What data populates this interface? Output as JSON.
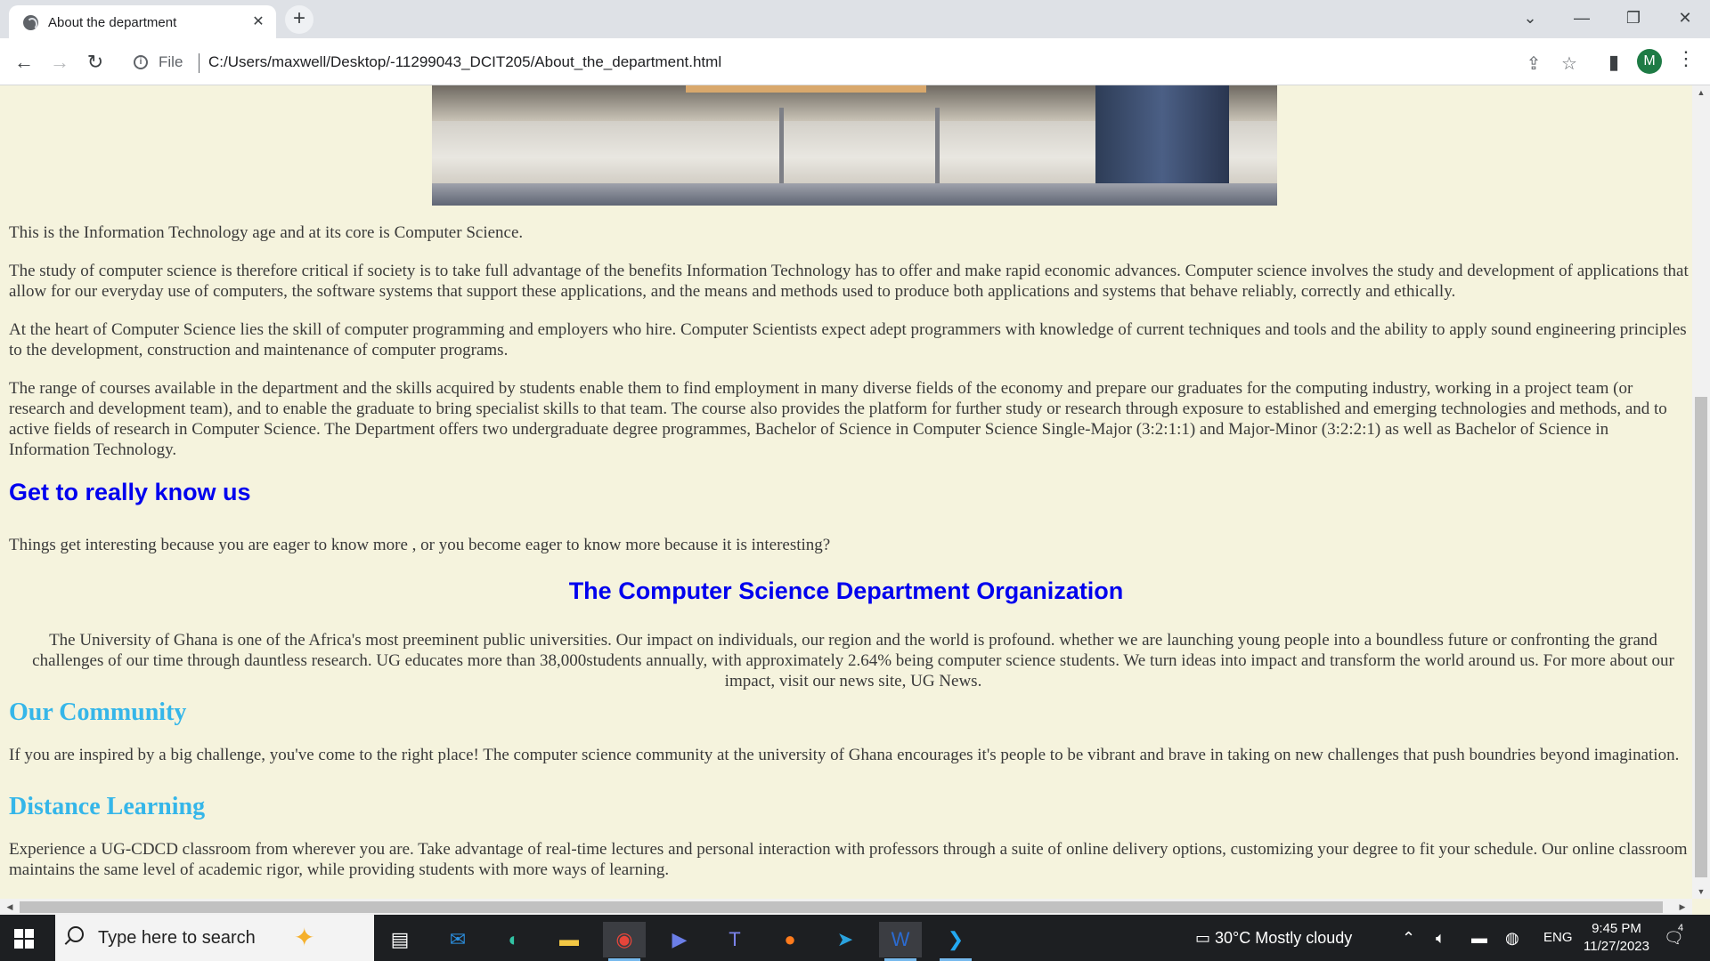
{
  "browser": {
    "tab_title": "About the department",
    "tab_close": "✕",
    "new_tab": "+",
    "file_label": "File",
    "url": "C:/Users/maxwell/Desktop/-11299043_DCIT205/About_the_department.html",
    "profile_initial": "M",
    "window_controls": {
      "tab_search": "⌄",
      "minimize": "—",
      "restore": "❐",
      "close": "✕"
    },
    "icons": [
      "back-icon",
      "forward-icon",
      "reload-icon",
      "info-icon",
      "share-icon",
      "bookmark-star-icon",
      "side-panel-icon",
      "kebab-menu-icon"
    ]
  },
  "page": {
    "hero_image": "classroom-photo",
    "paragraphs": [
      "This is the Information Technology age and at its core is Computer Science.",
      "The study of computer science is therefore critical if society is to take full advantage of the benefits Information Technology has to offer and make rapid economic advances. Computer science involves the study and development of applications that allow for our everyday use of computers, the software systems that support these applications, and the means and methods used to produce both applications and systems that behave reliably, correctly and ethically.",
      "At the heart of Computer Science lies the skill of computer programming and employers who hire. Computer Scientists expect adept programmers with knowledge of current techniques and tools and the ability to apply sound engineering principles to the development, construction and maintenance of computer programs.",
      "The range of courses available in the department and the skills acquired by students enable them to find employment in many diverse fields of the economy and prepare our graduates for the computing industry, working in a project team (or research and development team), and to enable the graduate to bring specialist skills to that team. The course also provides the platform for further study or research through exposure to established and emerging technologies and methods, and to active fields of research in Computer Science. The Department offers two undergraduate degree programmes, Bachelor of Science in Computer Science Single-Major (3:2:1:1) and Major-Minor (3:2:2:1) as well as Bachelor of Science in Information Technology."
    ],
    "know_us_heading": "Get to really know us",
    "know_us_text": "Things get interesting because you are eager to know more , or you become eager to know more because it is interesting?",
    "org_heading": "The Computer Science Department Organization",
    "org_text": "The University of Ghana is one of the Africa's most preeminent public universities. Our impact on individuals, our region and the world is profound. whether we are launching young people into a boundless future or confronting the grand challenges of our time through dauntless research. UG educates more than 38,000students annually, with approximately 2.64% being computer science students. We turn ideas into impact and transform the world around us. For more about our impact, visit our news site, UG News.",
    "community_heading": "Our Community",
    "community_text": "If you are inspired by a big challenge, you've come to the right place! The computer science community at the university of Ghana encourages it's people to be vibrant and brave in taking on new challenges that push boundries beyond imagination.",
    "distance_heading": "Distance Learning",
    "distance_text": "Experience a UG-CDCD classroom from wherever you are. Take advantage of real-time lectures and personal interaction with professors through a suite of online delivery options, customizing your degree to fit your schedule. Our online classroom maintains the same level of academic rigor, while providing students with more ways of learning."
  },
  "taskbar": {
    "search_placeholder": "Type here to search",
    "weather": "30°C  Mostly cloudy",
    "language": "ENG",
    "time": "9:45 PM",
    "date": "11/27/2023",
    "notification_count": "4",
    "apps": [
      "task-view-icon",
      "mail-icon",
      "edge-icon",
      "file-explorer-icon",
      "chrome-icon",
      "copilot-icon",
      "teams-icon",
      "firefox-icon",
      "telegram-icon",
      "word-icon",
      "vscode-icon"
    ]
  },
  "colors": {
    "page_bg": "#f5f3dd",
    "heading_blue": "#0000ee",
    "heading_cyan": "#35b6e9",
    "text": "#3a3a3a"
  }
}
